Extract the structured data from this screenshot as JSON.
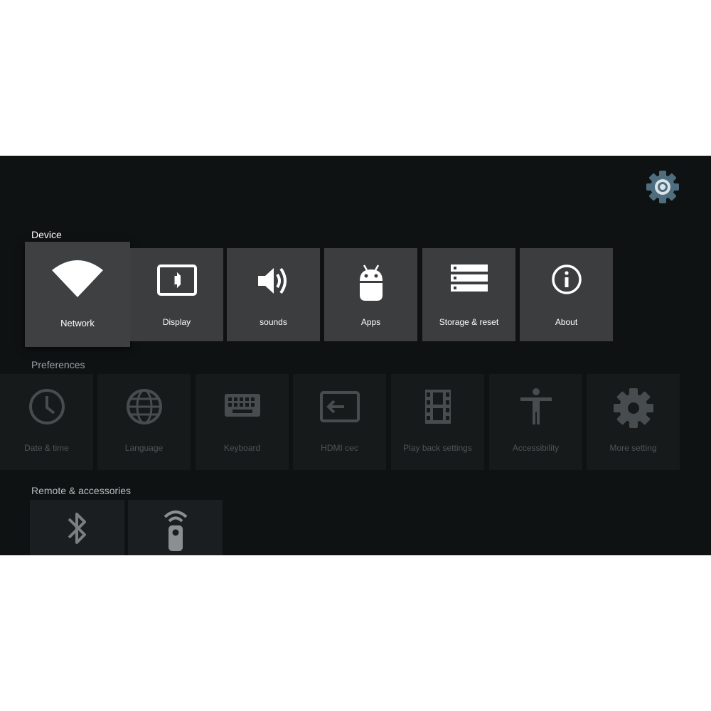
{
  "sections": {
    "device": {
      "title": "Device",
      "items": [
        {
          "label": "Network",
          "icon": "wifi-icon"
        },
        {
          "label": "Display",
          "icon": "display-icon"
        },
        {
          "label": "sounds",
          "icon": "volume-icon"
        },
        {
          "label": "Apps",
          "icon": "android-icon"
        },
        {
          "label": "Storage & reset",
          "icon": "storage-icon"
        },
        {
          "label": "About",
          "icon": "info-icon"
        }
      ]
    },
    "preferences": {
      "title": "Preferences",
      "items": [
        {
          "label": "Date & time",
          "icon": "clock-icon"
        },
        {
          "label": "Language",
          "icon": "globe-icon"
        },
        {
          "label": "Keyboard",
          "icon": "keyboard-icon"
        },
        {
          "label": "HDMI cec",
          "icon": "input-icon"
        },
        {
          "label": "Play back settings",
          "icon": "film-icon"
        },
        {
          "label": "Accessibility",
          "icon": "accessibility-icon"
        },
        {
          "label": "More setting",
          "icon": "gear-icon"
        }
      ]
    },
    "remote": {
      "title": "Remote & accessories",
      "items": [
        {
          "icon": "bluetooth-icon"
        },
        {
          "icon": "remote-icon"
        }
      ]
    }
  },
  "colors": {
    "background": "#0f1213",
    "tile_device": "#3b3d3f",
    "tile_preferences": "#171a1b",
    "accent_gear": "#4e6e80"
  }
}
